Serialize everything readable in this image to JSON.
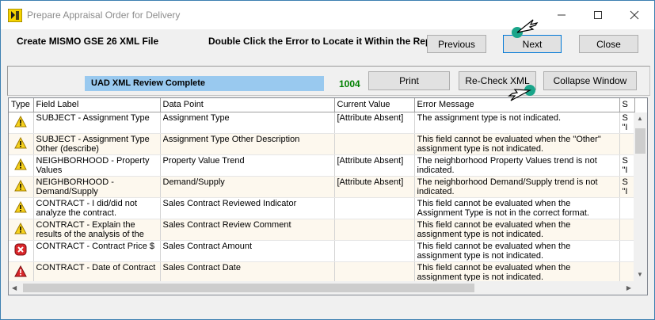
{
  "window": {
    "title": "Prepare Appraisal Order for Delivery"
  },
  "header": {
    "left_text": "Create MISMO GSE 26 XML File",
    "instruction": "Double Click the Error to Locate it Within the Report",
    "previous_label": "Previous",
    "next_label": "Next",
    "close_label": "Close"
  },
  "panel": {
    "status": "UAD XML Review Complete",
    "count": "1004",
    "print_label": "Print",
    "recheck_label": "Re-Check XML",
    "collapse_label": "Collapse Window"
  },
  "grid": {
    "columns": [
      "Type",
      "Field Label",
      "Data Point",
      "Current Value",
      "Error Message",
      "S"
    ],
    "rows": [
      {
        "type": "warning-icon",
        "field": "SUBJECT - Assignment Type",
        "point": "Assignment Type",
        "value": "[Attribute Absent]",
        "message": "The assignment type is not indicated.",
        "extra": "S\n\"I"
      },
      {
        "type": "warning-icon",
        "field": "SUBJECT - Assignment Type Other (describe)",
        "point": "Assignment Type Other Description",
        "value": "",
        "message": "This field cannot be evaluated when the \"Other\" assignment type is not indicated.",
        "extra": ""
      },
      {
        "type": "warning-icon",
        "field": "NEIGHBORHOOD - Property Values",
        "point": "Property Value Trend",
        "value": "[Attribute Absent]",
        "message": "The neighborhood Property Values trend is not indicated.",
        "extra": "S\n\"I"
      },
      {
        "type": "warning-icon",
        "field": "NEIGHBORHOOD - Demand/Supply",
        "point": "Demand/Supply",
        "value": "[Attribute Absent]",
        "message": "The neighborhood Demand/Supply trend is not indicated.",
        "extra": "S\n\"I"
      },
      {
        "type": "warning-icon",
        "field": "CONTRACT - I did/did not analyze the contract.",
        "point": "Sales Contract Reviewed Indicator",
        "value": "",
        "message": "This field cannot be evaluated when the Assignment Type is not in the correct format.",
        "extra": ""
      },
      {
        "type": "warning-icon",
        "field": "CONTRACT - Explain the results of the analysis of the contract.",
        "point": "Sales Contract Review Comment",
        "value": "",
        "message": "This field cannot be evaluated when the assignment type is not indicated.",
        "extra": ""
      },
      {
        "type": "error-x-icon",
        "field": "CONTRACT - Contract Price $",
        "point": "Sales Contract Amount",
        "value": "",
        "message": "This field cannot be evaluated when the assignment type is not indicated.",
        "extra": ""
      },
      {
        "type": "error-alert-icon",
        "field": "CONTRACT - Date of Contract",
        "point": "Sales Contract Date",
        "value": "",
        "message": "This field cannot be evaluated when the assignment type is not indicated.",
        "extra": ""
      }
    ]
  },
  "colors": {
    "status_highlight": "#99c9ef",
    "count_green": "#008000",
    "warning_yellow": "#f7d21b",
    "error_red": "#d9262a",
    "cursor_teal": "#1aa58a"
  }
}
